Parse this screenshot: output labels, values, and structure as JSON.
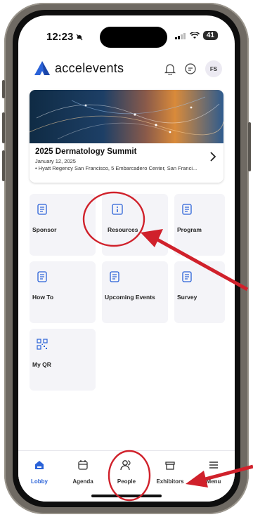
{
  "status_bar": {
    "time": "12:23",
    "battery": "41"
  },
  "app": {
    "brand": "accelevents",
    "avatar_initials": "FS",
    "accent": "#2a62d8"
  },
  "event": {
    "title": "2025 Dermatology Summit",
    "date": "January 12, 2025",
    "location": "Hyatt Regency San Francisco, 5 Embarcadero Center, San Franci..."
  },
  "tiles": [
    {
      "label": "Sponsor",
      "icon": "document-icon"
    },
    {
      "label": "Resources",
      "icon": "info-icon"
    },
    {
      "label": "Program",
      "icon": "document-icon"
    },
    {
      "label": "How To",
      "icon": "document-icon"
    },
    {
      "label": "Upcoming Events",
      "icon": "document-icon"
    },
    {
      "label": "Survey",
      "icon": "document-icon"
    },
    {
      "label": "My QR",
      "icon": "qr-icon"
    }
  ],
  "tabs": [
    {
      "label": "Lobby",
      "icon": "home-icon",
      "active": true
    },
    {
      "label": "Agenda",
      "icon": "calendar-icon"
    },
    {
      "label": "People",
      "icon": "people-icon"
    },
    {
      "label": "Exhibitors",
      "icon": "store-icon"
    },
    {
      "label": "Menu",
      "icon": "menu-icon"
    }
  ],
  "annotation_color": "#d0212b"
}
